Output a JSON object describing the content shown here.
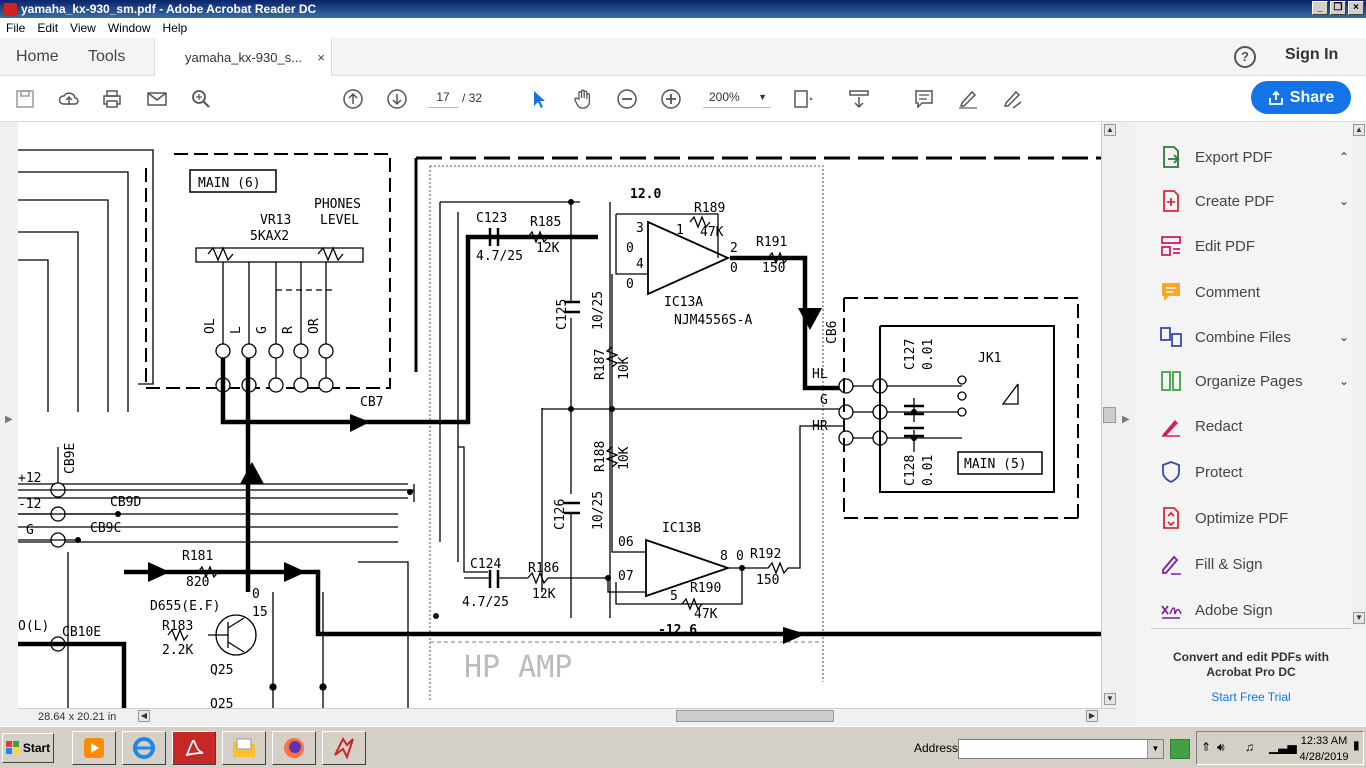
{
  "window": {
    "title": "yamaha_kx-930_sm.pdf - Adobe Acrobat Reader DC"
  },
  "menu": [
    "File",
    "Edit",
    "View",
    "Window",
    "Help"
  ],
  "tabs": {
    "home": "Home",
    "tools": "Tools",
    "document": "yamaha_kx-930_s...",
    "close": "×"
  },
  "header": {
    "help": "?",
    "sign_in": "Sign In"
  },
  "toolbar": {
    "page_current": "17",
    "page_total": "/ 32",
    "zoom": "200%",
    "share": "Share"
  },
  "status": {
    "page_dims": "28.64 x 20.21 in"
  },
  "right_pane": {
    "items": [
      {
        "label": "Export PDF",
        "chev": "⌃",
        "color": "#2e7d32"
      },
      {
        "label": "Create PDF",
        "chev": "⌄",
        "color": "#d32f2f"
      },
      {
        "label": "Edit PDF",
        "chev": "",
        "color": "#d81b60"
      },
      {
        "label": "Comment",
        "chev": "",
        "color": "#f9a825"
      },
      {
        "label": "Combine Files",
        "chev": "⌄",
        "color": "#3949ab"
      },
      {
        "label": "Organize Pages",
        "chev": "⌄",
        "color": "#43a047"
      },
      {
        "label": "Redact",
        "chev": "",
        "color": "#d81b60"
      },
      {
        "label": "Protect",
        "chev": "",
        "color": "#3949ab"
      },
      {
        "label": "Optimize PDF",
        "chev": "",
        "color": "#d32f2f"
      },
      {
        "label": "Fill & Sign",
        "chev": "",
        "color": "#7b1fa2"
      },
      {
        "label": "Adobe Sign",
        "chev": "",
        "color": "#7b1fa2"
      }
    ],
    "promo": "Convert and edit PDFs with Acrobat Pro DC",
    "trial": "Start Free Trial"
  },
  "taskbar": {
    "start": "Start",
    "address_label": "Address",
    "time": "12:33 AM",
    "date": "4/28/2019"
  },
  "schematic": {
    "labels": {
      "main6": "MAIN (6)",
      "phones": "PHONES",
      "level": "LEVEL",
      "vr13": "VR13",
      "vr13v": "5KAX2",
      "c123": "C123",
      "c123v": "4.7/25",
      "r185": "R185",
      "r185v": "12K",
      "v120": "12.0",
      "r189": "R189",
      "r189v": "47K",
      "r191": "R191",
      "r191v": "150",
      "ic13a": "IC13A",
      "njm": "NJM4556S-A",
      "cb6": "CB6",
      "c127": "C127",
      "c127v": "0.01",
      "jk1": "JK1",
      "hl": "HL",
      "g": "G",
      "hr": "HR",
      "main5": "MAIN (5)",
      "c128": "C128",
      "c128v": "0.01",
      "c125": "C125",
      "c125v": "10/25",
      "r187": "R187",
      "r187v": "10K",
      "r188": "R188",
      "r188v": "10K",
      "c126": "C126",
      "c126v": "10/25",
      "ic13b": "IC13B",
      "c124": "C124",
      "c124v": "4.7/25",
      "r186": "R186",
      "r186v": "12K",
      "r192": "R192",
      "r192v": "150",
      "r190": "R190",
      "r190v": "47K",
      "v126": "-12.6",
      "cb7": "CB7",
      "cb9e": "CB9E",
      "p12": "+12",
      "m12": "-12",
      "gnd": "G",
      "cb9d": "CB9D",
      "cb9c": "CB9C",
      "r181": "R181",
      "r181v": "820",
      "d655": "D655(E.F)",
      "r183": "R183",
      "r183v": "2.2K",
      "q25": "Q25",
      "cb10e": "CB10E",
      "ol": "O(L)",
      "hpamp": "HP AMP",
      "q25b": "Q25",
      "p0a": "0",
      "p0b": "0",
      "p3": "3",
      "p1": "1",
      "p2": "2",
      "p4": "4",
      "p0c": "0",
      "p06": "06",
      "p07": "07",
      "p8": "8",
      "p0d": "0",
      "p5": "5",
      "p15": "15",
      "p0e": "0",
      "pin_ol": "OL",
      "pin_l": "L",
      "pin_g": "G",
      "pin_r": "R",
      "pin_or": "OR"
    }
  }
}
